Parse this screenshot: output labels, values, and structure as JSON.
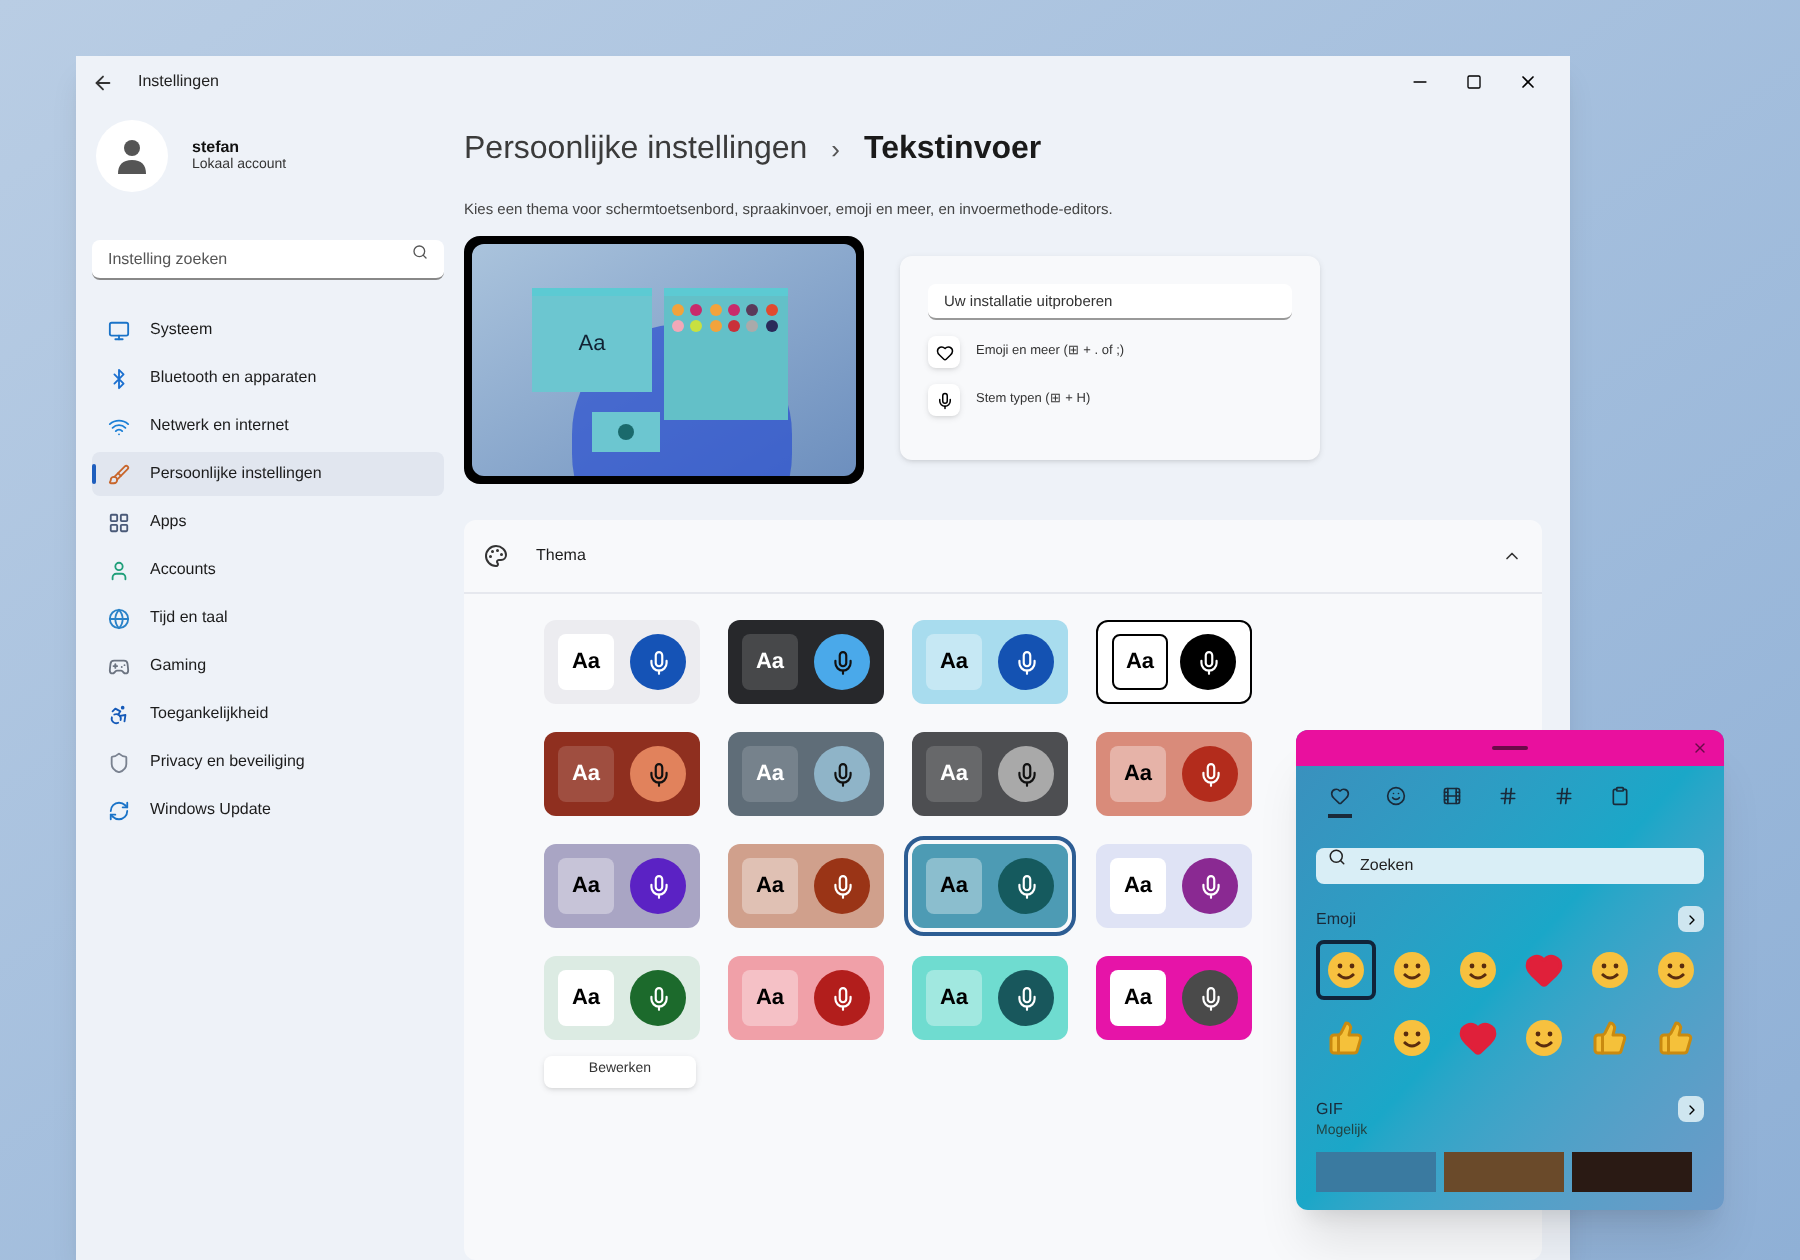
{
  "window": {
    "title": "Instellingen"
  },
  "account": {
    "name": "stefan",
    "type": "Lokaal account"
  },
  "search": {
    "placeholder": "Instelling zoeken"
  },
  "sidebar": {
    "items": [
      {
        "label": "Systeem",
        "kind": "system",
        "selected": false
      },
      {
        "label": "Bluetooth en apparaten",
        "kind": "bluetooth",
        "selected": false
      },
      {
        "label": "Netwerk en internet",
        "kind": "network",
        "selected": false
      },
      {
        "label": "Persoonlijke instellingen",
        "kind": "brush",
        "selected": true
      },
      {
        "label": "Apps",
        "kind": "apps",
        "selected": false
      },
      {
        "label": "Accounts",
        "kind": "accounts",
        "selected": false
      },
      {
        "label": "Tijd en taal",
        "kind": "time",
        "selected": false
      },
      {
        "label": "Gaming",
        "kind": "gaming",
        "selected": false
      },
      {
        "label": "Toegankelijkheid",
        "kind": "access",
        "selected": false
      },
      {
        "label": "Privacy en beveiliging",
        "kind": "privacy",
        "selected": false
      },
      {
        "label": "Windows Update",
        "kind": "update",
        "selected": false
      }
    ]
  },
  "breadcrumb": {
    "parent": "Persoonlijke instellingen",
    "separator": "›",
    "current": "Tekstinvoer"
  },
  "description": "Kies een thema voor schermtoetsenbord, spraakinvoer, emoji en meer, en invoermethode-editors.",
  "preview": {
    "aa": "Aa",
    "input_placeholder": "Uw installatie uitproberen",
    "shortcuts": [
      {
        "kind": "emoji",
        "label": "Emoji en meer (⊞ + . of ;)"
      },
      {
        "kind": "voice",
        "label": "Stem typen (⊞ + H)"
      }
    ]
  },
  "theme_section": {
    "title": "Thema",
    "expanded": true,
    "edit_button": "Bewerken",
    "themes": [
      {
        "aa": "Aa",
        "kind": "light",
        "tile": {
          "color": "#ececf0"
        },
        "mic": {
          "color": "#1553b6"
        },
        "selected": false
      },
      {
        "aa": "Aa",
        "kind": "dark",
        "tile": {
          "color": "#27282b"
        },
        "mic": {
          "color": "#4aa9ea"
        },
        "selected": false
      },
      {
        "aa": "Aa",
        "kind": "tint",
        "tile": {
          "color": "#a8dcee"
        },
        "mic": {
          "color": "#1452b2"
        },
        "selected": false
      },
      {
        "aa": "Aa",
        "kind": "outline",
        "tile": {
          "color": "#ffffff"
        },
        "mic": {
          "color": "#000000"
        },
        "selected": false
      },
      {
        "aa": "Aa",
        "kind": "dark",
        "tile": {
          "color": "#8f2f1f"
        },
        "mic": {
          "color": "#e1825c"
        },
        "selected": false
      },
      {
        "aa": "Aa",
        "kind": "dark",
        "tile": {
          "color": "#5f6d78"
        },
        "mic": {
          "color": "#8fb4c8"
        },
        "selected": false
      },
      {
        "aa": "Aa",
        "kind": "dark",
        "tile": {
          "color": "#4d4e51"
        },
        "mic": {
          "color": "#a9a9a9"
        },
        "selected": false
      },
      {
        "aa": "Aa",
        "kind": "tint",
        "tile": {
          "color": "#d98b7a"
        },
        "mic": {
          "color": "#b32c1c"
        },
        "selected": false
      },
      {
        "aa": "Aa",
        "kind": "tint",
        "tile": {
          "color": "#a9a5c4"
        },
        "mic": {
          "color": "#5b22c4"
        },
        "selected": false
      },
      {
        "aa": "Aa",
        "kind": "tint",
        "tile": {
          "color": "#d0a08c"
        },
        "mic": {
          "color": "#9a3416"
        },
        "selected": false
      },
      {
        "aa": "Aa",
        "kind": "tint",
        "tile": {
          "color": "#4d9bb4"
        },
        "mic": {
          "color": "#155a5e"
        },
        "selected": true
      },
      {
        "aa": "Aa",
        "kind": "light",
        "tile": {
          "color": "#dfe3f5"
        },
        "mic": {
          "color": "#8a2992"
        },
        "selected": false
      },
      {
        "aa": "Aa",
        "kind": "light",
        "tile": {
          "color": "#dcebe3"
        },
        "mic": {
          "color": "#1c6a2c"
        },
        "selected": false
      },
      {
        "aa": "Aa",
        "kind": "tint",
        "tile": {
          "color": "#f0a0a8"
        },
        "mic": {
          "color": "#b21e1c"
        },
        "selected": false
      },
      {
        "aa": "Aa",
        "kind": "tint",
        "tile": {
          "color": "#6fdcd0"
        },
        "mic": {
          "color": "#18575c"
        },
        "selected": false
      },
      {
        "aa": "Aa",
        "kind": "light",
        "tile": {
          "color": "#e614a8"
        },
        "mic": {
          "color": "#4a4a4a"
        },
        "selected": false
      }
    ]
  },
  "emoji_panel": {
    "tabs": [
      {
        "kind": "emoji",
        "selected": true
      },
      {
        "kind": "kaomoji-face",
        "selected": false
      },
      {
        "kind": "gif",
        "selected": false
      },
      {
        "kind": "kaomoji",
        "selected": false
      },
      {
        "kind": "symbols",
        "selected": false
      },
      {
        "kind": "clipboard",
        "selected": false
      }
    ],
    "search_placeholder": "Zoeken",
    "emoji_heading": "Emoji",
    "emojis": [
      {
        "kind": "face",
        "selected": true
      },
      {
        "kind": "face",
        "selected": false
      },
      {
        "kind": "face",
        "selected": false
      },
      {
        "kind": "heart",
        "selected": false
      },
      {
        "kind": "face",
        "selected": false
      },
      {
        "kind": "face",
        "selected": false
      },
      {
        "kind": "hand",
        "selected": false
      },
      {
        "kind": "face",
        "selected": false
      },
      {
        "kind": "heart",
        "selected": false
      },
      {
        "kind": "face",
        "selected": false
      },
      {
        "kind": "hand",
        "selected": false
      },
      {
        "kind": "hand",
        "selected": false
      }
    ],
    "gif_heading": "GIF",
    "gif_subtitle": "Mogelijk"
  }
}
